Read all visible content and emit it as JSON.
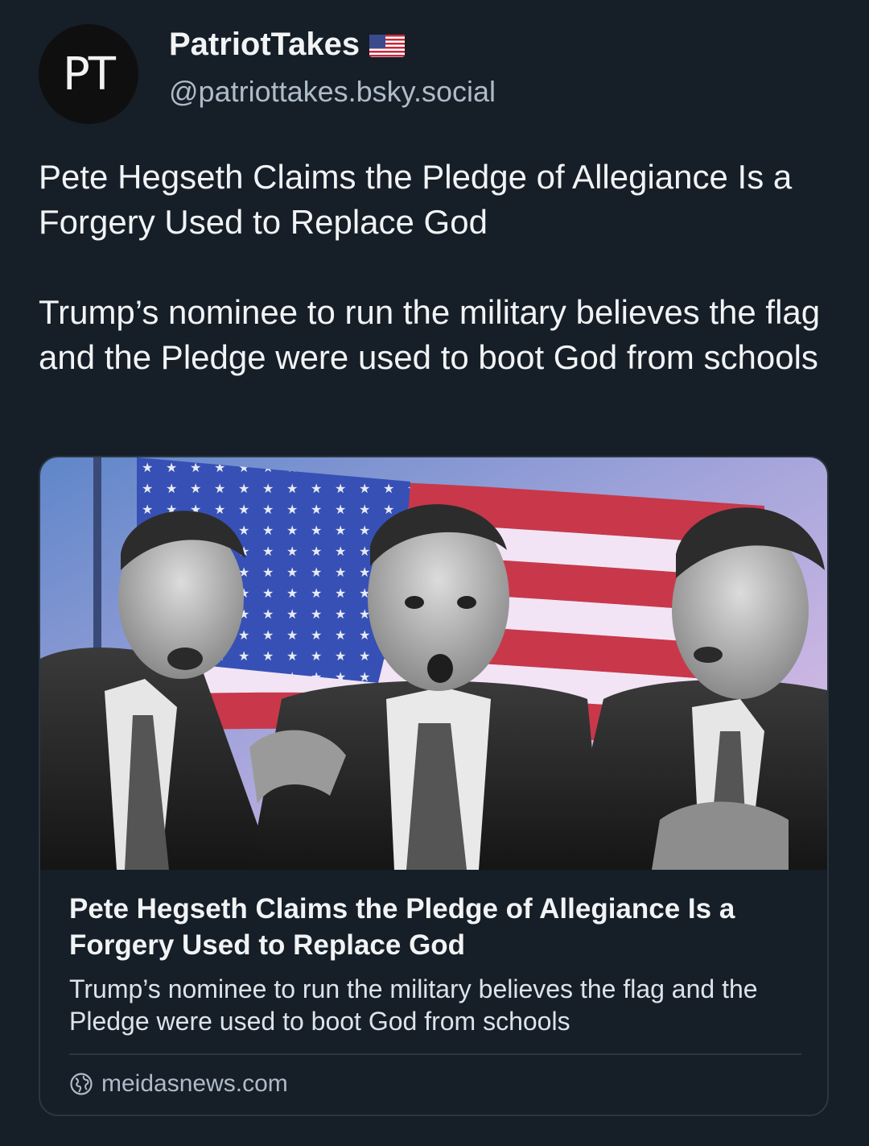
{
  "author": {
    "display_name": "PatriotTakes",
    "handle": "@patriottakes.bsky.social",
    "avatar_text": "PT",
    "flag_icon": "us-flag-icon"
  },
  "post": {
    "text": "Pete Hegseth Claims the Pledge of Allegiance Is a Forgery Used to Replace God\n\nTrump’s nominee to run the military believes the flag and the Pledge were used to boot God from schools"
  },
  "link_card": {
    "title": "Pete Hegseth Claims the Pledge of Allegiance Is a Forgery Used to Replace God",
    "description": "Trump’s nominee to run the military believes the flag and the Pledge were used to boot God from schools",
    "domain": "meidasnews.com",
    "domain_icon": "globe-icon"
  },
  "colors": {
    "background": "#161e27",
    "text_primary": "#f1f3f5",
    "text_secondary": "#aebbc9",
    "border": "#2b3642"
  }
}
